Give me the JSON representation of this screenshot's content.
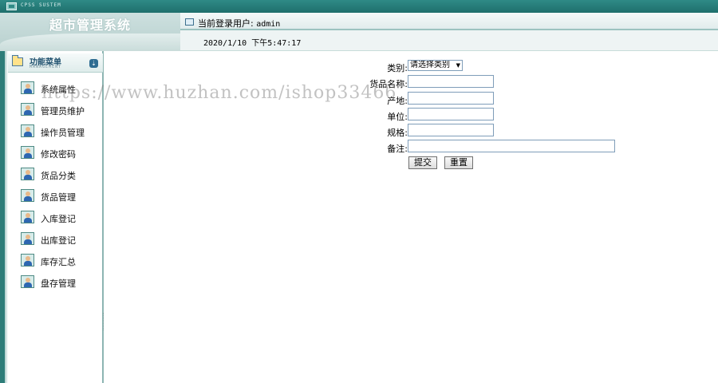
{
  "window": {
    "strip_text": "CPSS SUSTEM"
  },
  "header": {
    "app_title": "超市管理系统",
    "user_label": "当前登录用户:",
    "username": "admin",
    "datetime": "2020/1/10 下午5:47:17"
  },
  "sidebar": {
    "title": "功能菜单",
    "subtitle": "MANAGEMENT",
    "items": [
      {
        "label": "系统属性",
        "icon": "user-icon"
      },
      {
        "label": "管理员维护",
        "icon": "user-icon"
      },
      {
        "label": "操作员管理",
        "icon": "user-icon"
      },
      {
        "label": "修改密码",
        "icon": "user-icon"
      },
      {
        "label": "货品分类",
        "icon": "user-icon"
      },
      {
        "label": "货品管理",
        "icon": "user-icon"
      },
      {
        "label": "入库登记",
        "icon": "user-icon"
      },
      {
        "label": "出库登记",
        "icon": "user-icon"
      },
      {
        "label": "库存汇总",
        "icon": "user-icon"
      },
      {
        "label": "盘存管理",
        "icon": "user-icon"
      }
    ]
  },
  "form": {
    "category_label": "类别:",
    "category_value": "请选择类别",
    "name_label": "货品名称:",
    "origin_label": "产地:",
    "unit_label": "单位:",
    "spec_label": "规格:",
    "remark_label": "备注:",
    "submit_label": "提交",
    "reset_label": "重置"
  },
  "watermark": "https://www.huzhan.com/ishop33466",
  "colors": {
    "accent": "#2e7d79",
    "header_bg": "#cde0df"
  }
}
